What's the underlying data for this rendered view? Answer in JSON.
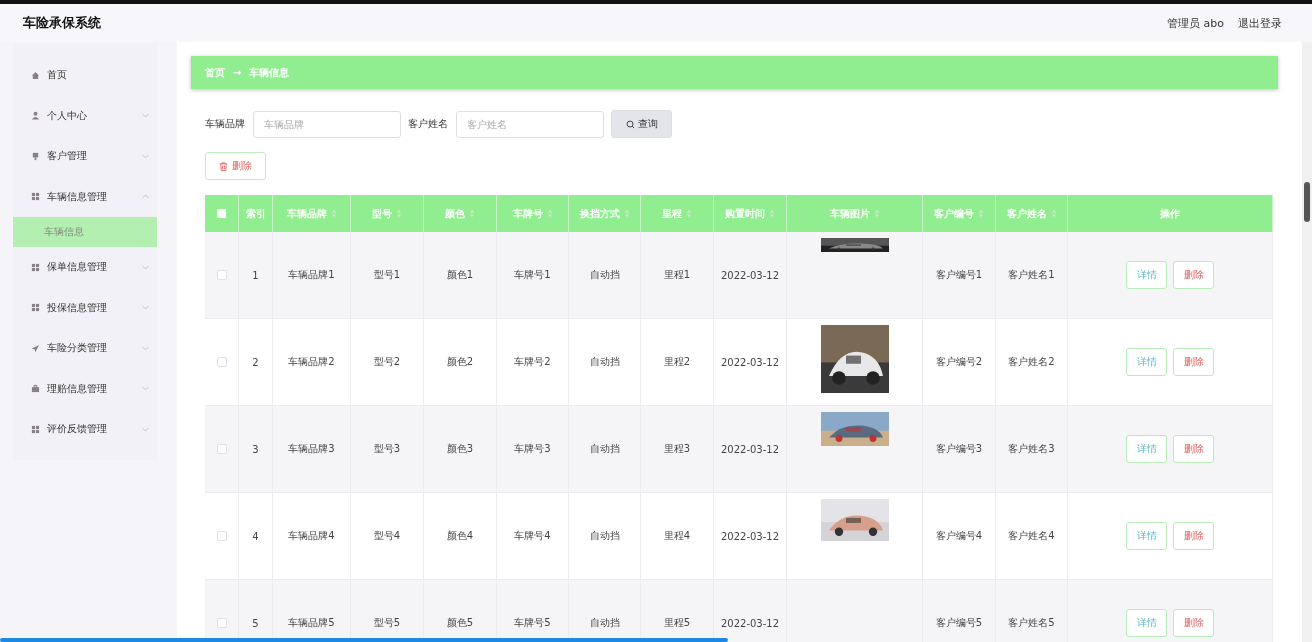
{
  "header": {
    "title": "车险承保系统",
    "user": "管理员 abo",
    "logout": "退出登录"
  },
  "sidebar": {
    "items": [
      {
        "label": "首页"
      },
      {
        "label": "个人中心",
        "expanded": false
      },
      {
        "label": "客户管理",
        "expanded": false
      },
      {
        "label": "车辆信息管理",
        "expanded": true,
        "children": [
          {
            "label": "车辆信息",
            "selected": true
          }
        ]
      },
      {
        "label": "保单信息管理",
        "expanded": false
      },
      {
        "label": "投保信息管理",
        "expanded": false
      },
      {
        "label": "车险分类管理",
        "expanded": false
      },
      {
        "label": "理赔信息管理",
        "expanded": false
      },
      {
        "label": "评价反馈管理",
        "expanded": false
      }
    ]
  },
  "breadcrumb": [
    "首页",
    "车辆信息"
  ],
  "breadcrumb_separator": "→",
  "search": {
    "fields": [
      {
        "label": "车辆品牌",
        "placeholder": "车辆品牌"
      },
      {
        "label": "客户姓名",
        "placeholder": "客户姓名"
      }
    ],
    "button": "查询"
  },
  "delete_button": "删除",
  "table": {
    "select_all": {
      "checked": false
    },
    "columns": [
      {
        "label": "索引",
        "sortable": false
      },
      {
        "label": "车辆品牌",
        "sortable": true
      },
      {
        "label": "型号",
        "sortable": true
      },
      {
        "label": "颜色",
        "sortable": true
      },
      {
        "label": "车牌号",
        "sortable": true
      },
      {
        "label": "换挡方式",
        "sortable": true
      },
      {
        "label": "里程",
        "sortable": true
      },
      {
        "label": "购置时间",
        "sortable": true
      },
      {
        "label": "车辆图片",
        "sortable": true
      },
      {
        "label": "客户编号",
        "sortable": true
      },
      {
        "label": "客户姓名",
        "sortable": true
      },
      {
        "label": "操作",
        "sortable": false
      }
    ],
    "rows": [
      {
        "checked": false,
        "cells": [
          "1",
          "车辆品牌1",
          "型号1",
          "颜色1",
          "车牌号1",
          "自动挡",
          "里程1",
          "2022-03-12"
        ],
        "photo": {
          "kind": "picture"
        },
        "cells_after": [
          "客户编号1",
          "客户姓名1"
        ],
        "actions": [
          "详情",
          "删除"
        ]
      },
      {
        "checked": false,
        "cells": [
          "2",
          "车辆品牌2",
          "型号2",
          "颜色2",
          "车牌号2",
          "自动挡",
          "里程2",
          "2022-03-12"
        ],
        "photo": {
          "kind": "picture"
        },
        "cells_after": [
          "客户编号2",
          "客户姓名2"
        ],
        "actions": [
          "详情",
          "删除"
        ]
      },
      {
        "checked": false,
        "cells": [
          "3",
          "车辆品牌3",
          "型号3",
          "颜色3",
          "车牌号3",
          "自动挡",
          "里程3",
          "2022-03-12"
        ],
        "photo": {
          "kind": "picture"
        },
        "cells_after": [
          "客户编号3",
          "客户姓名3"
        ],
        "actions": [
          "详情",
          "删除"
        ]
      },
      {
        "checked": false,
        "cells": [
          "4",
          "车辆品牌4",
          "型号4",
          "颜色4",
          "车牌号4",
          "自动挡",
          "里程4",
          "2022-03-12"
        ],
        "photo": {
          "kind": "picture"
        },
        "cells_after": [
          "客户编号4",
          "客户姓名4"
        ],
        "actions": [
          "详情",
          "删除"
        ]
      },
      {
        "checked": false,
        "cells": [
          "5",
          "车辆品牌5",
          "型号5",
          "颜色5",
          "车牌号5",
          "自动挡",
          "里程5",
          "2022-03-12"
        ],
        "cells_after": [
          "客户编号5",
          "客户姓名5"
        ],
        "actions": [
          "详情",
          "删除"
        ]
      }
    ]
  }
}
